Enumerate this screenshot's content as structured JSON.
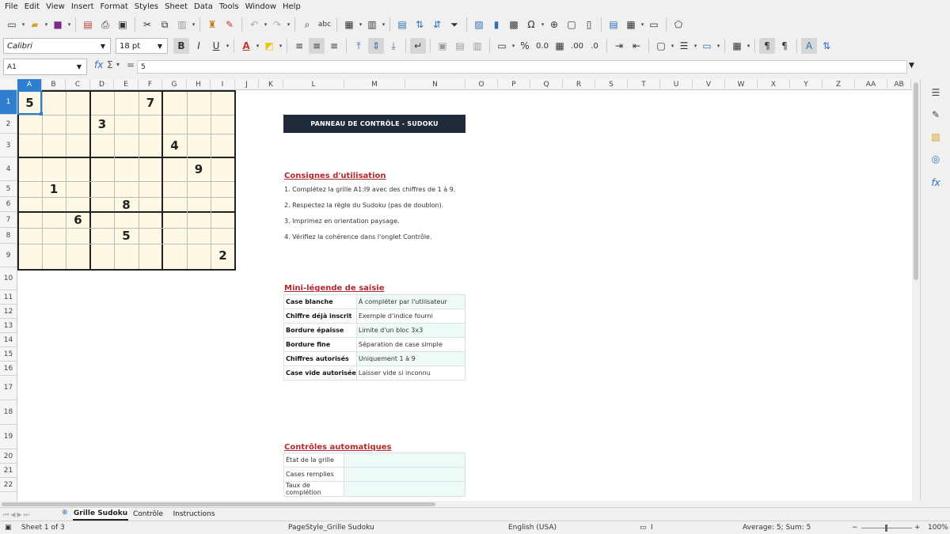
{
  "menu": [
    "File",
    "Edit",
    "View",
    "Insert",
    "Format",
    "Styles",
    "Sheet",
    "Data",
    "Tools",
    "Window",
    "Help"
  ],
  "font": {
    "name": "Calibri",
    "size": "18 pt"
  },
  "namebox": "A1",
  "formula": {
    "fx": "fx",
    "sigma": "Σ",
    "eq": "=",
    "value": "5"
  },
  "columns": [
    {
      "l": "A",
      "w": 31
    },
    {
      "l": "B",
      "w": 30
    },
    {
      "l": "C",
      "w": 31
    },
    {
      "l": "D",
      "w": 30
    },
    {
      "l": "E",
      "w": 31
    },
    {
      "l": "F",
      "w": 30
    },
    {
      "l": "G",
      "w": 31
    },
    {
      "l": "H",
      "w": 30
    },
    {
      "l": "I",
      "w": 31
    },
    {
      "l": "J",
      "w": 30
    },
    {
      "l": "K",
      "w": 31
    },
    {
      "l": "L",
      "w": 77
    },
    {
      "l": "M",
      "w": 77
    },
    {
      "l": "N",
      "w": 76
    },
    {
      "l": "O",
      "w": 41
    },
    {
      "l": "P",
      "w": 41
    },
    {
      "l": "Q",
      "w": 41
    },
    {
      "l": "R",
      "w": 41
    },
    {
      "l": "S",
      "w": 41
    },
    {
      "l": "T",
      "w": 41
    },
    {
      "l": "U",
      "w": 41
    },
    {
      "l": "V",
      "w": 41
    },
    {
      "l": "W",
      "w": 41
    },
    {
      "l": "X",
      "w": 41
    },
    {
      "l": "Y",
      "w": 41
    },
    {
      "l": "Z",
      "w": 41
    },
    {
      "l": "AA",
      "w": 41
    },
    {
      "l": "AB",
      "w": 30
    }
  ],
  "rows": [
    {
      "n": "1",
      "h": 31
    },
    {
      "n": "2",
      "h": 24
    },
    {
      "n": "3",
      "h": 30
    },
    {
      "n": "4",
      "h": 30
    },
    {
      "n": "5",
      "h": 20
    },
    {
      "n": "6",
      "h": 19
    },
    {
      "n": "7",
      "h": 20
    },
    {
      "n": "8",
      "h": 20
    },
    {
      "n": "9",
      "h": 30
    },
    {
      "n": "10",
      "h": 29
    },
    {
      "n": "11",
      "h": 18
    },
    {
      "n": "12",
      "h": 18
    },
    {
      "n": "13",
      "h": 18
    },
    {
      "n": "14",
      "h": 18
    },
    {
      "n": "15",
      "h": 18
    },
    {
      "n": "16",
      "h": 18
    },
    {
      "n": "17",
      "h": 31
    },
    {
      "n": "18",
      "h": 31
    },
    {
      "n": "19",
      "h": 31
    },
    {
      "n": "20",
      "h": 18
    },
    {
      "n": "21",
      "h": 18
    },
    {
      "n": "22",
      "h": 18
    }
  ],
  "sudoku": {
    "givens": [
      {
        "r": 0,
        "c": 0,
        "v": "5"
      },
      {
        "r": 0,
        "c": 5,
        "v": "7"
      },
      {
        "r": 1,
        "c": 3,
        "v": "3"
      },
      {
        "r": 2,
        "c": 6,
        "v": "4"
      },
      {
        "r": 3,
        "c": 7,
        "v": "9"
      },
      {
        "r": 4,
        "c": 1,
        "v": "1"
      },
      {
        "r": 5,
        "c": 4,
        "v": "8"
      },
      {
        "r": 6,
        "c": 2,
        "v": "6"
      },
      {
        "r": 7,
        "c": 4,
        "v": "5"
      },
      {
        "r": 8,
        "c": 8,
        "v": "2"
      }
    ]
  },
  "panel": {
    "banner": "PANNEAU DE CONTRÔLE - SUDOKU",
    "consignes_title": "Consignes d'utilisation",
    "consignes": [
      "1. Complétez la grille A1:I9 avec des chiffres de 1 à 9.",
      "2. Respectez la règle du Sudoku (pas de doublon).",
      "3. Imprimez en orientation paysage.",
      "4. Vérifiez la cohérence dans l'onglet Contrôle."
    ],
    "legend_title": "Mini-légende de saisie",
    "legend": [
      {
        "k": "Case blanche",
        "v": "À compléter par l'utilisateur"
      },
      {
        "k": "Chiffre déjà inscrit",
        "v": "Exemple d'indice fourni"
      },
      {
        "k": "Bordure épaisse",
        "v": "Limite d'un bloc 3x3"
      },
      {
        "k": "Bordure fine",
        "v": "Séparation de case simple"
      },
      {
        "k": "Chiffres autorisés",
        "v": "Uniquement 1 à 9"
      },
      {
        "k": "Case vide autorisée",
        "v": "Laisser vide si inconnu"
      }
    ],
    "controls_title": "Contrôles automatiques",
    "controls": [
      {
        "k": "État de la grille",
        "v": ""
      },
      {
        "k": "Cases remplies",
        "v": ""
      },
      {
        "k": "Taux de complétion",
        "v": ""
      }
    ]
  },
  "tabs": [
    {
      "label": "Grille Sudoku",
      "active": true
    },
    {
      "label": "Contrôle",
      "active": false
    },
    {
      "label": "Instructions",
      "active": false
    }
  ],
  "status": {
    "sheet": "Sheet 1 of 3",
    "pagestyle": "PageStyle_Grille Sudoku",
    "language": "English (USA)",
    "summary": "Average: 5; Sum: 5",
    "zoom": "100%"
  }
}
